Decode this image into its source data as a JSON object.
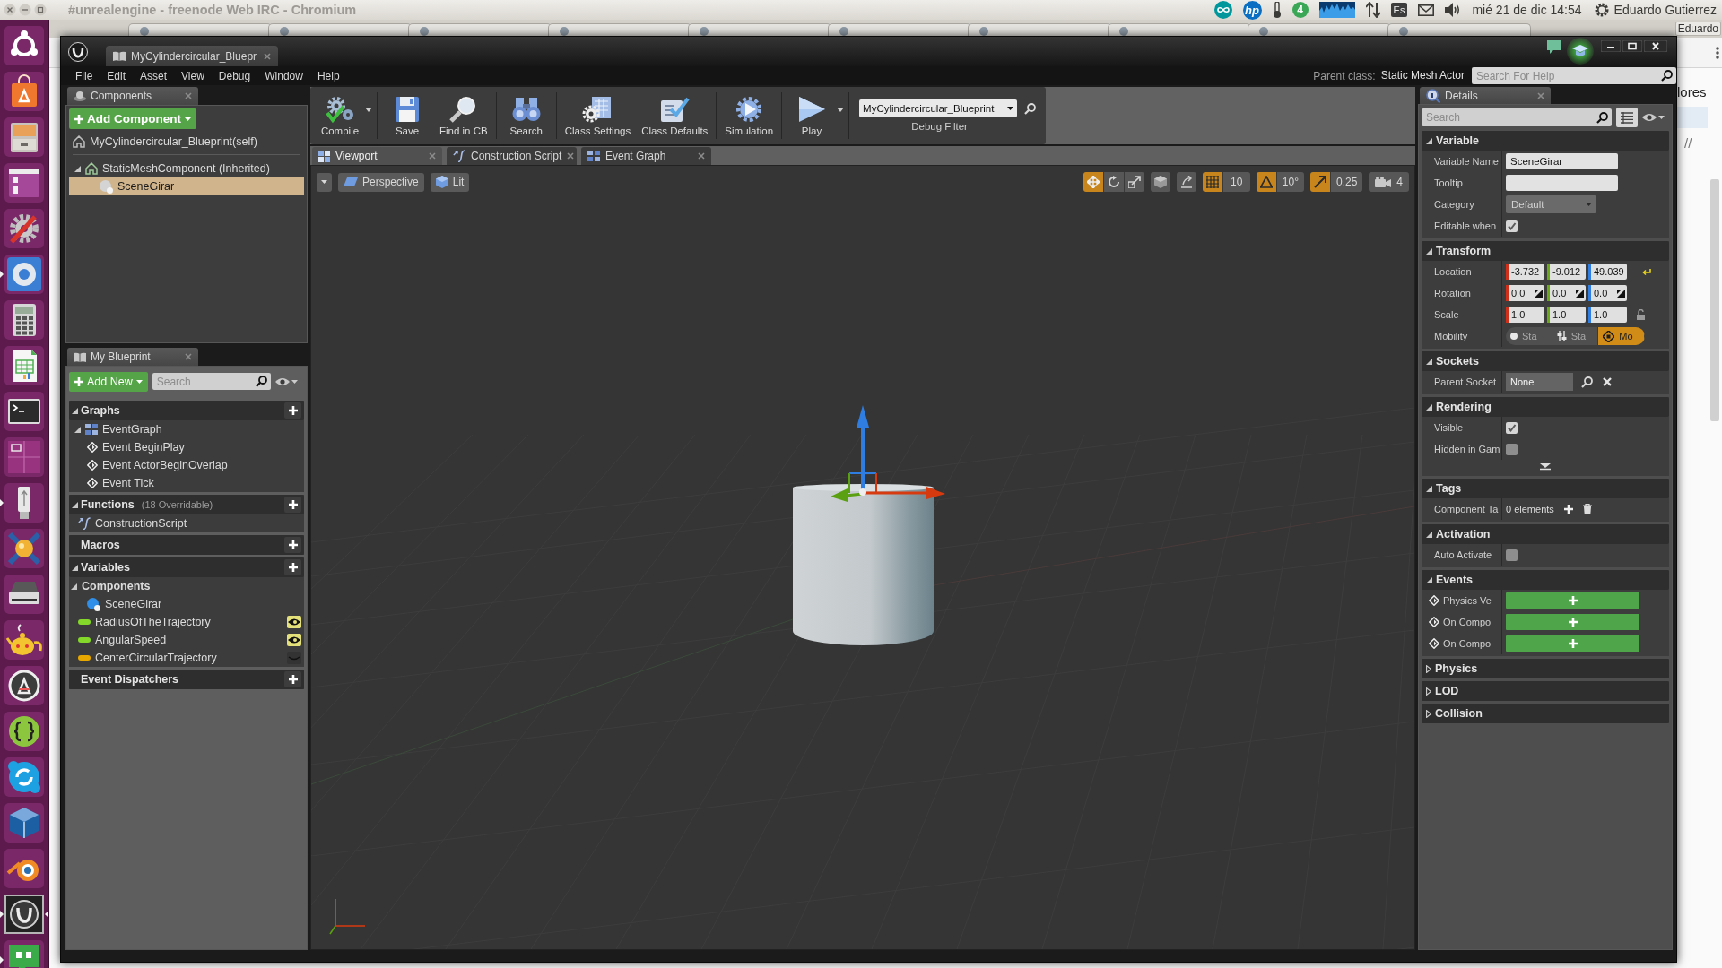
{
  "top_panel": {
    "window_title": "#unrealengine - freenode Web IRC - Chromium",
    "indicators": [
      {
        "kind": "infinity"
      },
      {
        "kind": "logo",
        "text": "hp"
      },
      {
        "kind": "thermometer"
      },
      {
        "kind": "badge",
        "text": "4"
      },
      {
        "kind": "graph"
      },
      {
        "kind": "transfer"
      },
      {
        "kind": "keyboard",
        "text": "Es"
      },
      {
        "kind": "mail"
      },
      {
        "kind": "volume"
      }
    ],
    "clock": "mié 21 de dic 14:54",
    "user": "Eduardo Gutierrez"
  },
  "launcher": [
    {
      "kind": "dash",
      "running": false,
      "focused": false
    },
    {
      "kind": "software",
      "running": false,
      "focused": false
    },
    {
      "kind": "files",
      "running": false,
      "focused": false
    },
    {
      "kind": "app",
      "running": false,
      "focused": false
    },
    {
      "kind": "settings",
      "running": false,
      "focused": false
    },
    {
      "kind": "browser",
      "running": true,
      "focused": false
    },
    {
      "kind": "calculator",
      "running": false,
      "focused": false
    },
    {
      "kind": "spreadsheet",
      "running": false,
      "focused": false
    },
    {
      "kind": "terminal",
      "running": false,
      "focused": false
    },
    {
      "kind": "workspaces",
      "running": false,
      "focused": false
    },
    {
      "kind": "usb",
      "running": true,
      "focused": false
    },
    {
      "kind": "orb",
      "running": false,
      "focused": false
    },
    {
      "kind": "scanner",
      "running": false,
      "focused": false
    },
    {
      "kind": "teapot",
      "running": false,
      "focused": false
    },
    {
      "kind": "updater",
      "running": false,
      "focused": false
    },
    {
      "kind": "braces",
      "running": false,
      "focused": false
    },
    {
      "kind": "chat",
      "running": false,
      "focused": false
    },
    {
      "kind": "cube",
      "running": false,
      "focused": false
    },
    {
      "kind": "orbit",
      "running": false,
      "focused": false
    },
    {
      "kind": "engine",
      "running": true,
      "focused": true
    },
    {
      "kind": "bubble",
      "running": true,
      "focused": false
    }
  ],
  "background_window": {
    "profile": "Eduardo",
    "page_texts": [
      "lores",
      "//"
    ]
  },
  "editor": {
    "document_tab": "MyCylindercircular_Bluepr",
    "menu": [
      "File",
      "Edit",
      "Asset",
      "View",
      "Debug",
      "Window",
      "Help"
    ],
    "parent_class": {
      "label": "Parent class:",
      "value": "Static Mesh Actor"
    },
    "help_search": {
      "placeholder": "Search For Help"
    },
    "components": {
      "tab": "Components",
      "add_button": "Add Component",
      "self_item": "MyCylindercircular_Blueprint(self)",
      "tree": [
        {
          "label": "StaticMeshComponent (Inherited)",
          "kind": "mesh",
          "selected": false,
          "children": [
            {
              "label": "SceneGirar",
              "kind": "scene",
              "selected": true
            }
          ]
        }
      ]
    },
    "my_blueprint": {
      "tab": "My Blueprint",
      "add_button": "Add New",
      "search": {
        "placeholder": "Search"
      },
      "sections": [
        {
          "title": "Graphs",
          "items": [
            {
              "label": "EventGraph",
              "kind": "graph",
              "children": [
                {
                  "label": "Event BeginPlay",
                  "kind": "event"
                },
                {
                  "label": "Event ActorBeginOverlap",
                  "kind": "event"
                },
                {
                  "label": "Event Tick",
                  "kind": "event"
                }
              ]
            }
          ]
        },
        {
          "title": "Functions",
          "note": "(18 Overridable)",
          "items": [
            {
              "label": "ConstructionScript",
              "kind": "function"
            }
          ]
        },
        {
          "title": "Macros"
        },
        {
          "title": "Variables",
          "items": [
            {
              "label": "Components",
              "kind": "category",
              "children": [
                {
                  "label": "SceneGirar",
                  "kind": "component"
                }
              ]
            },
            {
              "label": "RadiusOfTheTrajectory",
              "kind": "variable",
              "color": "#84d82a",
              "public": true
            },
            {
              "label": "AngularSpeed",
              "kind": "variable",
              "color": "#84d82a",
              "public": true
            },
            {
              "label": "CenterCircularTrajectory",
              "kind": "variable",
              "color": "#e8a800",
              "public": false
            }
          ]
        },
        {
          "title": "Event Dispatchers"
        }
      ]
    },
    "toolbar": {
      "groups": [
        [
          {
            "label": "Compile",
            "kind": "compile",
            "dropdown": true
          }
        ],
        [
          {
            "label": "Save",
            "kind": "save",
            "dropdown": false
          },
          {
            "label": "Find in CB",
            "kind": "find",
            "dropdown": false
          }
        ],
        [
          {
            "label": "Search",
            "kind": "binoculars",
            "dropdown": false
          }
        ],
        [
          {
            "label": "Class Settings",
            "kind": "settings",
            "dropdown": false
          },
          {
            "label": "Class Defaults",
            "kind": "defaults",
            "dropdown": false
          }
        ],
        [
          {
            "label": "Simulation",
            "kind": "simulation",
            "dropdown": false
          }
        ],
        [
          {
            "label": "Play",
            "kind": "play",
            "dropdown": true
          }
        ]
      ],
      "debug_filter": {
        "value": "MyCylindercircular_Blueprint",
        "label": "Debug Filter"
      }
    },
    "editor_tabs": [
      {
        "label": "Viewport",
        "kind": "viewport",
        "selected": true
      },
      {
        "label": "Construction Script",
        "kind": "function",
        "selected": false
      },
      {
        "label": "Event Graph",
        "kind": "graph",
        "selected": false
      }
    ],
    "viewport": {
      "view_mode": "Perspective",
      "lighting": "Lit",
      "transform_modes": [
        {
          "kind": "translate",
          "selected": true
        },
        {
          "kind": "rotate",
          "selected": false
        },
        {
          "kind": "scale",
          "selected": false
        }
      ],
      "surface_snapping": false,
      "snaps": [
        {
          "kind": "grid",
          "on": true,
          "value": "10"
        },
        {
          "kind": "rotation",
          "on": true,
          "value": "10°"
        },
        {
          "kind": "scale",
          "on": true,
          "value": "0.25"
        }
      ],
      "camera_speed": "4"
    },
    "details": {
      "tab": "Details",
      "search": {
        "placeholder": "Search"
      },
      "sections": [
        {
          "title": "Variable",
          "expanded": true,
          "rows": [
            {
              "label": "Variable Name",
              "kind": "text",
              "value": "SceneGirar"
            },
            {
              "label": "Tooltip",
              "kind": "text"
            },
            {
              "label": "Category",
              "kind": "select",
              "value": "Default"
            },
            {
              "label": "Editable when",
              "kind": "checkbox",
              "checked": true
            }
          ]
        },
        {
          "title": "Transform",
          "expanded": true,
          "rows": [
            {
              "label": "Location",
              "kind": "vector",
              "values": [
                "-3.732",
                "-9.012",
                "49.039"
              ],
              "reset": true
            },
            {
              "label": "Rotation",
              "kind": "rotator",
              "values": [
                "0.0",
                "0.0",
                "0.0"
              ],
              "reset": false
            },
            {
              "label": "Scale",
              "kind": "scale",
              "values": [
                "1.0",
                "1.0",
                "1.0"
              ],
              "reset": false,
              "locked": false
            },
            {
              "label": "Mobility",
              "kind": "mobility",
              "options": [
                {
                  "label": "Sta",
                  "kind": "static",
                  "selected": false
                },
                {
                  "label": "Sta",
                  "kind": "stationary",
                  "selected": false
                },
                {
                  "label": "Mo",
                  "kind": "movable",
                  "selected": true
                }
              ]
            }
          ]
        },
        {
          "title": "Sockets",
          "expanded": true,
          "rows": [
            {
              "label": "Parent Socket",
              "kind": "socket",
              "value": "None"
            }
          ]
        },
        {
          "title": "Rendering",
          "expanded": true,
          "rows": [
            {
              "label": "Visible",
              "kind": "checkbox",
              "checked": true
            },
            {
              "label": "Hidden in Gam",
              "kind": "checkbox",
              "checked": false
            },
            {
              "kind": "advanced"
            }
          ]
        },
        {
          "title": "Tags",
          "expanded": true,
          "rows": [
            {
              "label": "Component Ta",
              "kind": "array",
              "value": "0 elements"
            }
          ]
        },
        {
          "title": "Activation",
          "expanded": true,
          "rows": [
            {
              "label": "Auto Activate",
              "kind": "checkbox",
              "checked": false
            }
          ]
        },
        {
          "title": "Events",
          "expanded": true,
          "rows": [
            {
              "label": "Physics Ve",
              "kind": "event"
            },
            {
              "label": "On Compo",
              "kind": "event"
            },
            {
              "label": "On Compo",
              "kind": "event"
            }
          ]
        },
        {
          "title": "Physics",
          "expanded": false
        },
        {
          "title": "LOD",
          "expanded": false
        },
        {
          "title": "Collision",
          "expanded": false
        }
      ]
    }
  }
}
